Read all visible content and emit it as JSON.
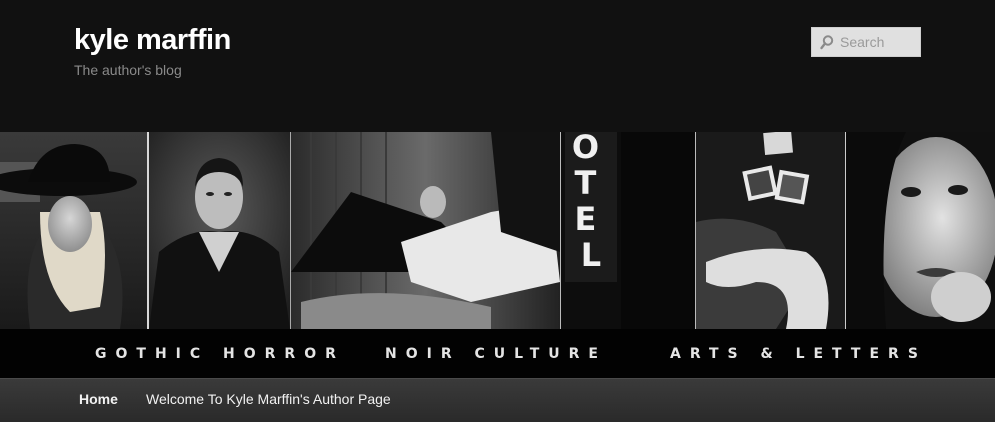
{
  "site": {
    "title": "kyle marffin",
    "description": "The author's blog"
  },
  "search": {
    "placeholder": "Search",
    "icon": "search-icon"
  },
  "banner": {
    "genres": [
      "GOTHIC HORROR",
      "NOIR CULTURE",
      "ARTS & LETTERS"
    ],
    "motel_sign": "OTEL",
    "panels": [
      "woman-in-hat",
      "vampire-portrait",
      "man-reclining-with-glass",
      "motel-neon-sign",
      "woman-with-photographs",
      "woman-closeup-face"
    ]
  },
  "nav": {
    "items": [
      {
        "label": "Home",
        "active": true
      },
      {
        "label": "Welcome To Kyle Marffin's Author Page",
        "active": false
      }
    ]
  },
  "colors": {
    "background": "#111111",
    "nav_background": "#333333",
    "search_background": "#e0e0e0",
    "text_primary": "#ffffff",
    "text_secondary": "#8a8a8a"
  }
}
